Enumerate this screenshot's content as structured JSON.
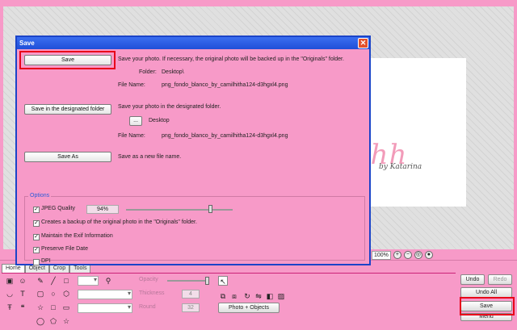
{
  "dialog": {
    "title": "Save",
    "close_glyph": "✕",
    "save": {
      "button": "Save",
      "description": "Save your photo. If necessary, the original photo will be backed up in the \"Originals\" folder.",
      "folder_label": "Folder:",
      "folder_value": "Desktop\\",
      "filename_label": "File Name:",
      "filename_value": "png_fondo_blanco_by_camilhitha124-d3hgxl4.png"
    },
    "save_designated": {
      "button": "Save in the designated folder",
      "description": "Save your photo in the designated folder.",
      "browse": "...",
      "folder_value": "Desktop",
      "filename_label": "File Name:",
      "filename_value": "png_fondo_blanco_by_camilhitha124-d3hgxl4.png"
    },
    "save_as": {
      "button": "Save As",
      "description": "Save as a new file name."
    },
    "options": {
      "title": "Options",
      "jpeg_quality_label": "JPEG Quality",
      "jpeg_quality_value": "94%",
      "jpeg_quality_level": 0.94,
      "backup_label": "Creates a backup of the original photo in the \"Originals\" folder.",
      "exif_label": "Maintain the Exif Information",
      "date_label": "Preserve File Date",
      "dpi_label": "DPI",
      "checked": {
        "jpeg": true,
        "backup": true,
        "exif": true,
        "date": true,
        "dpi": false
      }
    }
  },
  "canvas": {
    "photo_text": "reahh",
    "photo_byline": "by Katarina",
    "zoom": "100%"
  },
  "bottom": {
    "tabs": [
      "Home",
      "Object",
      "Crop",
      "Tools"
    ],
    "opacity_label": "Opacity",
    "thickness_label": "Thickness",
    "thickness_value": "4",
    "round_label": "Round",
    "round_value": "32",
    "photo_objects_button": "Photo + Objects"
  },
  "right_panel": {
    "undo": "Undo",
    "redo": "Redo",
    "undo_all": "Undo All",
    "save": "Save",
    "menu": "Menu"
  },
  "colors": {
    "pink": "#f79ac8",
    "titlebar": "#1f4fd8",
    "highlight": "#e8001a",
    "options_title": "#2a5bd8"
  }
}
